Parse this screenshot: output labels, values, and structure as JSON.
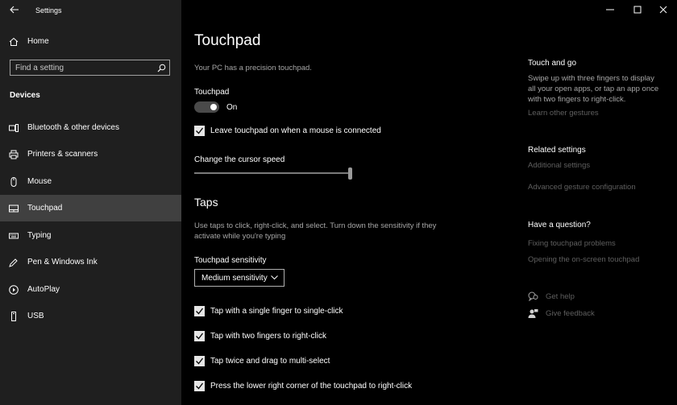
{
  "window": {
    "title": "Settings",
    "controls": [
      "minimize",
      "maximize",
      "close"
    ]
  },
  "sidebar": {
    "home_label": "Home",
    "search_placeholder": "Find a setting",
    "section_title": "Devices",
    "items": [
      {
        "label": "Bluetooth & other devices",
        "icon": "bluetooth-devices-icon"
      },
      {
        "label": "Printers & scanners",
        "icon": "printer-icon"
      },
      {
        "label": "Mouse",
        "icon": "mouse-icon"
      },
      {
        "label": "Touchpad",
        "icon": "touchpad-icon",
        "selected": true
      },
      {
        "label": "Typing",
        "icon": "keyboard-icon"
      },
      {
        "label": "Pen & Windows Ink",
        "icon": "pen-icon"
      },
      {
        "label": "AutoPlay",
        "icon": "autoplay-icon"
      },
      {
        "label": "USB",
        "icon": "usb-icon"
      }
    ]
  },
  "main": {
    "title": "Touchpad",
    "precision_note": "Your PC has a precision touchpad.",
    "touchpad_label": "Touchpad",
    "toggle_state": "On",
    "leave_on_label": "Leave touchpad on when a mouse is connected",
    "cursor_speed_label": "Change the cursor speed",
    "cursor_speed_value": 1.0,
    "taps_title": "Taps",
    "taps_description_line1": "Use taps to click, right-click, and select. Turn down the sensitivity if they",
    "taps_description_line2": "activate while you're typing",
    "sensitivity_label": "Touchpad sensitivity",
    "sensitivity_value": "Medium sensitivity",
    "tap_options": [
      "Tap with a single finger to single-click",
      "Tap with two fingers to right-click",
      "Tap twice and drag to multi-select",
      "Press the lower right corner of the touchpad to right-click"
    ]
  },
  "right": {
    "touch_and_go_title": "Touch and go",
    "touch_and_go_lines": [
      "Swipe up with three fingers to display",
      "all your open apps, or tap an app once",
      "with two fingers to right-click."
    ],
    "learn_link": "Learn other gestures",
    "related_title": "Related settings",
    "related_links": [
      "Additional settings",
      "Advanced gesture configuration"
    ],
    "question_title": "Have a question?",
    "question_links": [
      "Fixing touchpad problems",
      "Opening the on-screen touchpad"
    ],
    "get_help": "Get help",
    "give_feedback": "Give feedback"
  },
  "colors": {
    "sidebar_bg": "#1f1f1f",
    "selected_bg": "#404040",
    "main_bg": "#000000",
    "muted_text": "#a6a6a6",
    "dim_link": "#5f5f5f"
  }
}
